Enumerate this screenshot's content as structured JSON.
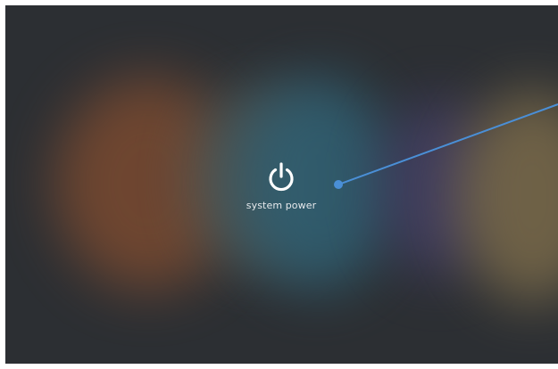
{
  "screen": {
    "power_button": {
      "icon": "power-icon",
      "label": "system power"
    }
  },
  "colors": {
    "background": "#2c2f33",
    "icon": "#ffffff",
    "label": "#e6e9ec",
    "annotation_line": "#4a8fd6"
  }
}
